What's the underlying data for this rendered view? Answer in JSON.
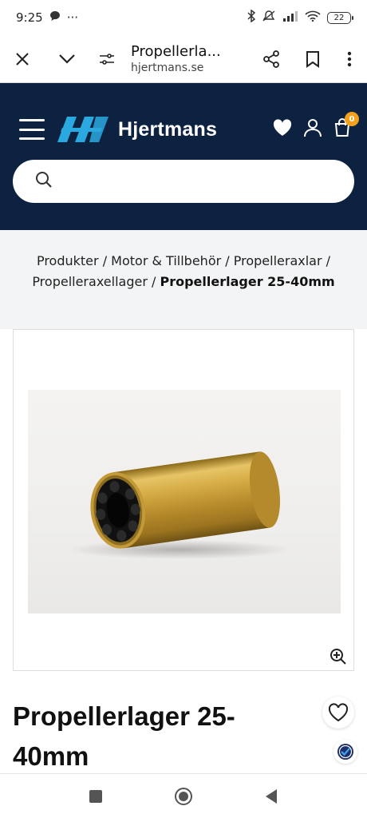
{
  "status_bar": {
    "time": "9:25",
    "more": "···",
    "battery": "22"
  },
  "browser": {
    "page_title": "Propellerla...",
    "domain": "hjertmans.se",
    "icons": [
      "close-icon",
      "chevron-down-icon",
      "tune-icon",
      "share-icon",
      "bookmark-icon",
      "more-vert-icon"
    ]
  },
  "header": {
    "logo_text": "Hjertmans",
    "cart_count": "0",
    "brand_color": "#0c2240",
    "logo_accent": "#2aa9e0",
    "badge_color": "#f4a01a"
  },
  "search": {
    "placeholder": ""
  },
  "breadcrumb": {
    "items": [
      "Produkter",
      "Motor & Tillbehör",
      "Propelleraxlar",
      "Propelleraxellager"
    ],
    "current": "Propellerlager 25-40mm",
    "separator": "/"
  },
  "product": {
    "title_line1": "Propellerlager 25-",
    "title_line2": "40mm"
  },
  "nav": {
    "icons": [
      "recents-icon",
      "home-icon",
      "back-icon"
    ]
  }
}
